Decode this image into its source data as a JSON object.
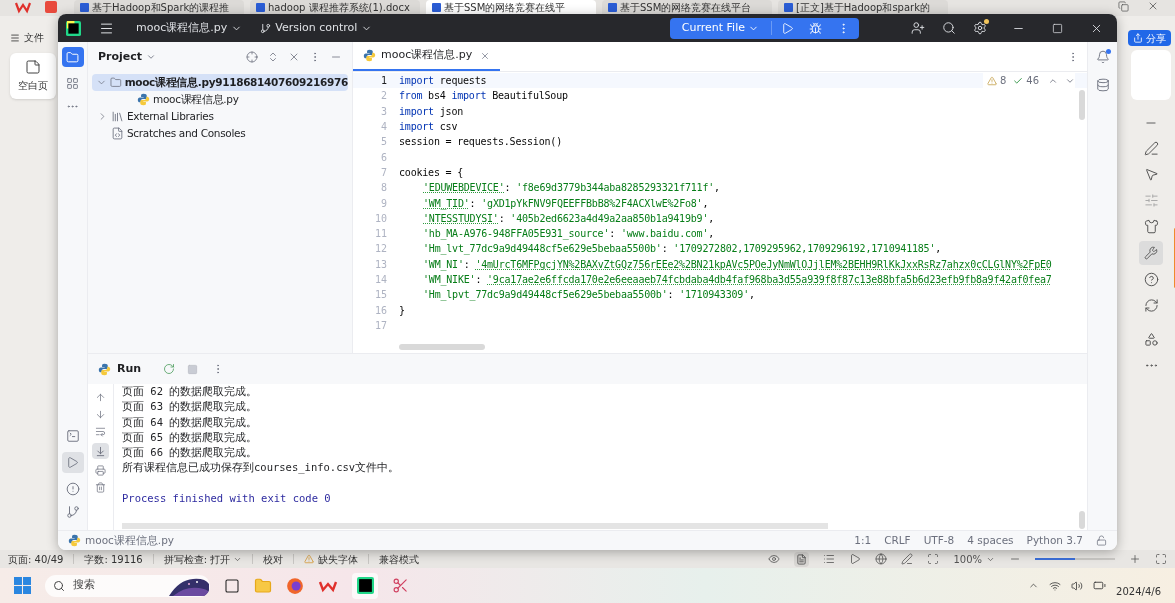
{
  "wps": {
    "tabs": [
      {
        "label": "基于Hadoop和Spark的课程推",
        "selected": false
      },
      {
        "label": "hadoop 课程推荐系统(1).docx",
        "selected": false
      },
      {
        "label": "基于SSM的网络竞赛在线平",
        "selected": true
      },
      {
        "label": "基于SSM的网络竞赛在线平台",
        "selected": false
      },
      {
        "label": "[正文]基于Hadoop和spark的",
        "selected": false
      }
    ],
    "menu": "文件",
    "new_button": "空白页",
    "share_button": "分享",
    "status": [
      "页面: 40/49",
      "字数: 19116",
      "拼写检查: 打开",
      "校对",
      "缺失字体",
      "兼容模式"
    ],
    "zoom": "100%",
    "zoom_slider": {
      "level": 0.5
    }
  },
  "pycharm": {
    "project_menu": "mooc课程信息.py",
    "vcs_menu": "Version control",
    "run_config": "Current File",
    "panel_title": "Project",
    "tree": [
      {
        "label": "mooc课程信息.py9118681407609216976",
        "kind": "folder",
        "expanded": true,
        "selected": true,
        "children": [
          {
            "label": "mooc课程信息.py",
            "kind": "python",
            "selected": false
          }
        ]
      },
      {
        "label": "External Libraries",
        "kind": "library",
        "expanded": false,
        "selected": false
      },
      {
        "label": "Scratches and Consoles",
        "kind": "scratch",
        "selected": false
      }
    ],
    "tab": "mooc课程信息.py",
    "warnings": "8",
    "checks": "46",
    "lines": [
      {
        "number": "1",
        "tokens": [
          {
            "kind": "keyword",
            "text": "import"
          },
          {
            "kind": "plain",
            "text": " requests"
          }
        ]
      },
      {
        "number": "2",
        "tokens": [
          {
            "kind": "keyword",
            "text": "from"
          },
          {
            "kind": "plain",
            "text": " bs4 "
          },
          {
            "kind": "keyword",
            "text": "import"
          },
          {
            "kind": "plain",
            "text": " BeautifulSoup"
          }
        ]
      },
      {
        "number": "3",
        "tokens": [
          {
            "kind": "keyword",
            "text": "import"
          },
          {
            "kind": "plain",
            "text": " json"
          }
        ]
      },
      {
        "number": "4",
        "tokens": [
          {
            "kind": "keyword",
            "text": "import"
          },
          {
            "kind": "plain",
            "text": " csv"
          }
        ]
      },
      {
        "number": "5",
        "tokens": [
          {
            "kind": "plain",
            "text": "session = requests.Session()"
          }
        ]
      },
      {
        "number": "6"
      },
      {
        "number": "7",
        "tokens": [
          {
            "kind": "plain",
            "text": "cookies = {"
          }
        ]
      },
      {
        "number": "8",
        "indented": true,
        "tokens": [
          {
            "kind": "typo",
            "text": "'EDUWEBDEVICE'"
          },
          {
            "kind": "plain",
            "text": ": "
          },
          {
            "kind": "string",
            "text": "'f8e69d3779b344aba8285293321f711f'"
          },
          {
            "kind": "plain",
            "text": ","
          }
        ]
      },
      {
        "number": "9",
        "indented": true,
        "tokens": [
          {
            "kind": "typo",
            "text": "'WM_TID'"
          },
          {
            "kind": "plain",
            "text": ": "
          },
          {
            "kind": "string",
            "text": "'gXD1pYkFNV9FQEEFFBbB8%2F4ACXlwE%2Fo8'"
          },
          {
            "kind": "plain",
            "text": ","
          }
        ]
      },
      {
        "number": "10",
        "indented": true,
        "tokens": [
          {
            "kind": "typo",
            "text": "'NTESSTUDYSI'"
          },
          {
            "kind": "plain",
            "text": ": "
          },
          {
            "kind": "string",
            "text": "'405b2ed6623a4d49a2aa850b1a9419b9'"
          },
          {
            "kind": "plain",
            "text": ","
          }
        ]
      },
      {
        "number": "11",
        "indented": true,
        "tokens": [
          {
            "kind": "string",
            "text": "'hb_MA-A976-948FFA05E931_source'"
          },
          {
            "kind": "plain",
            "text": ": "
          },
          {
            "kind": "string",
            "text": "'www.baidu.com'"
          },
          {
            "kind": "plain",
            "text": ","
          }
        ]
      },
      {
        "number": "12",
        "indented": true,
        "tokens": [
          {
            "kind": "string",
            "text": "'Hm_lvt_77dc9a9d49448cf5e629e5bebaa5500b'"
          },
          {
            "kind": "plain",
            "text": ": "
          },
          {
            "kind": "string",
            "text": "'1709272802,1709295962,1709296192,1710941185'"
          },
          {
            "kind": "plain",
            "text": ","
          }
        ]
      },
      {
        "number": "13",
        "indented": true,
        "tokens": [
          {
            "kind": "string",
            "text": "'WM_NI'"
          },
          {
            "kind": "plain",
            "text": ": "
          },
          {
            "kind": "typo",
            "text": "'4mUrcT6MFPgcjYN%2BAXvZtGQz756rEEe2%2BN21kpAVc5POeJyNmWlOJjlEM%2BEHH9RlKkJxxRsRz7ahzx0cCLGlNY%2FpE0"
          }
        ]
      },
      {
        "number": "14",
        "indented": true,
        "tokens": [
          {
            "kind": "string",
            "text": "'WM_NIKE'"
          },
          {
            "kind": "plain",
            "text": ": "
          },
          {
            "kind": "typo",
            "text": "'9ca17ae2e6ffcda170e2e6eeaaeb74fcbdaba4db4faf968ba3d55a939f8f87c13e88bfa5b6d23efb9fb8a9f42af0fea7"
          }
        ]
      },
      {
        "number": "15",
        "indented": true,
        "tokens": [
          {
            "kind": "string",
            "text": "'Hm_lpvt_77dc9a9d49448cf5e629e5bebaa5500b'"
          },
          {
            "kind": "plain",
            "text": ": "
          },
          {
            "kind": "string",
            "text": "'1710943309'"
          },
          {
            "kind": "plain",
            "text": ","
          }
        ]
      },
      {
        "number": "16",
        "tokens": [
          {
            "kind": "plain",
            "text": "}"
          }
        ]
      },
      {
        "number": "17"
      }
    ],
    "run": {
      "title": "Run",
      "output": [
        {
          "kind": "stdout",
          "text": "页面 62 的数据爬取完成。"
        },
        {
          "kind": "stdout",
          "text": "页面 63 的数据爬取完成。"
        },
        {
          "kind": "stdout",
          "text": "页面 64 的数据爬取完成。"
        },
        {
          "kind": "stdout",
          "text": "页面 65 的数据爬取完成。"
        },
        {
          "kind": "stdout",
          "text": "页面 66 的数据爬取完成。"
        },
        {
          "kind": "stdout",
          "text": "所有课程信息已成功保存到courses_info.csv文件中。"
        },
        {
          "kind": "exit",
          "text": "Process finished with exit code 0"
        }
      ]
    },
    "breadcrumb": "mooc课程信息.py",
    "status": [
      "1:1",
      "CRLF",
      "UTF-8",
      "4 spaces",
      "Python 3.7"
    ]
  },
  "taskbar": {
    "search_placeholder": "搜索",
    "date": "2024/4/6"
  }
}
